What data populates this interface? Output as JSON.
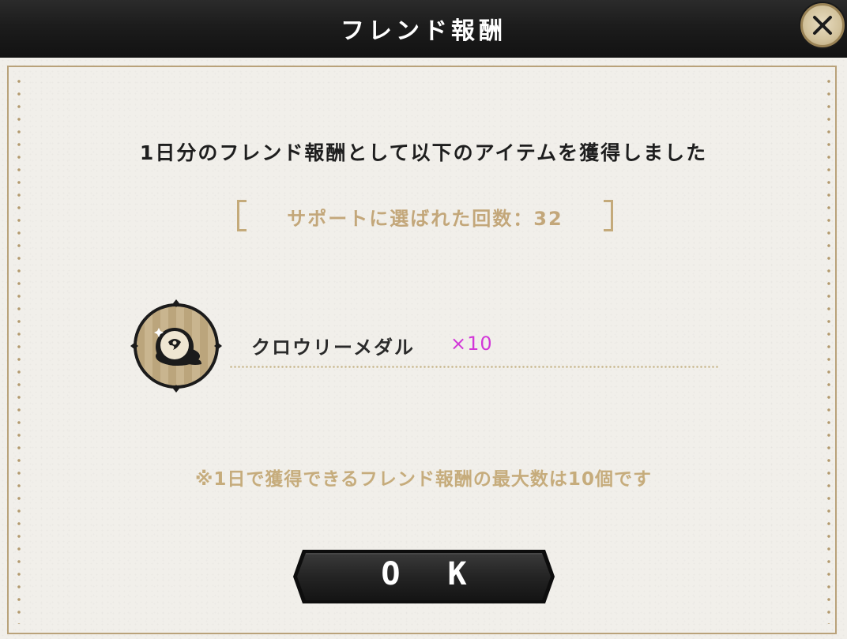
{
  "dialog": {
    "title": "フレンド報酬",
    "close_icon": "close-x-icon"
  },
  "content": {
    "message": "1日分のフレンド報酬として以下のアイテムを獲得しました",
    "support_count_text": "サポートに選ばれた回数：32",
    "support_count": 32,
    "reward": {
      "icon": "crowley-medal-icon",
      "name": "クロウリーメダル",
      "quantity_text": "×10",
      "quantity": 10
    },
    "note": "※1日で獲得できるフレンド報酬の最大数は10個です"
  },
  "ok_button": {
    "label": "O K"
  },
  "colors": {
    "title_bar": "#1c1c1c",
    "panel": "#f1efea",
    "gold_accent": "#c4aa7a",
    "quantity": "#d237d8"
  }
}
